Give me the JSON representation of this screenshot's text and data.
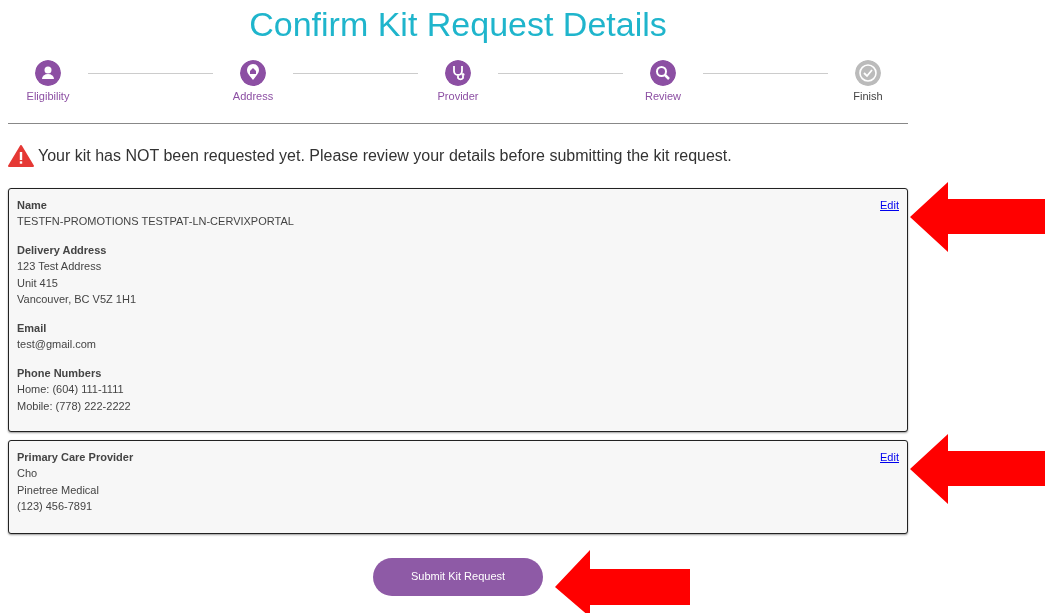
{
  "title": "Confirm Kit Request Details",
  "steps": [
    {
      "label": "Eligibility",
      "done": true
    },
    {
      "label": "Address",
      "done": true
    },
    {
      "label": "Provider",
      "done": true
    },
    {
      "label": "Review",
      "done": true
    },
    {
      "label": "Finish",
      "done": false
    }
  ],
  "warning": "Your kit has NOT been requested yet. Please review your details before submitting the kit request.",
  "sections": [
    {
      "edit": "Edit",
      "groups": [
        {
          "heading": "Name",
          "lines": [
            "TESTFN-PROMOTIONS TESTPAT-LN-CERVIXPORTAL"
          ]
        },
        {
          "heading": "Delivery Address",
          "lines": [
            "123 Test Address",
            "Unit 415",
            "Vancouver, BC V5Z 1H1"
          ]
        },
        {
          "heading": "Email",
          "lines": [
            "test@gmail.com"
          ]
        },
        {
          "heading": "Phone Numbers",
          "lines": [
            "Home: (604) 111-1111",
            "Mobile: (778) 222-2222"
          ]
        }
      ]
    },
    {
      "edit": "Edit",
      "groups": [
        {
          "heading": "Primary Care Provider",
          "lines": [
            "Cho",
            "Pinetree Medical",
            "(123) 456-7891"
          ]
        }
      ]
    }
  ],
  "submit": "Submit Kit Request"
}
